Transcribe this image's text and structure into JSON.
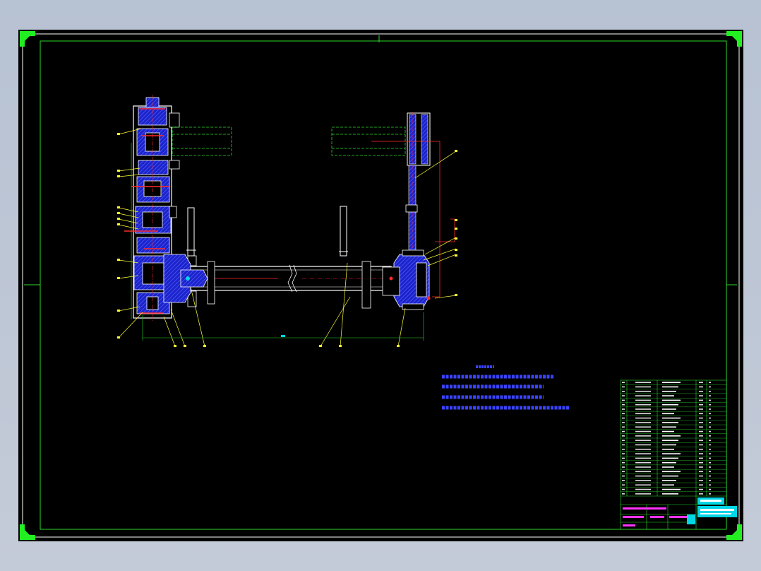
{
  "colors": {
    "background": "#b7c2d3",
    "sheet": "#000000",
    "frame": "#2bd92b",
    "corner_marker": "#22ee22",
    "geometry": "#ffffff",
    "hatch": "#2a35ff",
    "leader": "#ffff33",
    "centerline": "#ff2a2a",
    "notes": "#3a44ff",
    "title_cyan": "#00d6e6",
    "title_magenta": "#ff33ff"
  },
  "icons": [
    "corner-marker-icon"
  ]
}
